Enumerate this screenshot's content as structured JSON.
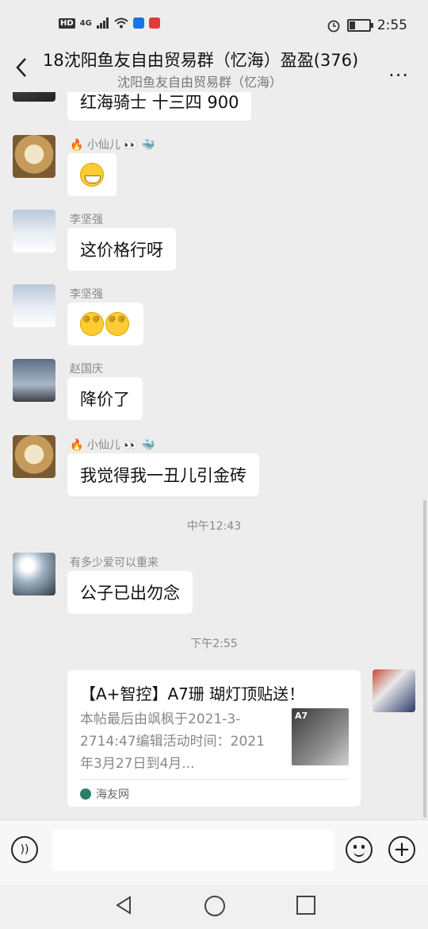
{
  "status_bar": {
    "left_text": "HD",
    "network": "4G",
    "time": "2:55"
  },
  "header": {
    "title": "18沈阳鱼友自由贸易群（忆海）盈盈(376)",
    "subtitle": "沈阳鱼友自由贸易群（忆海）",
    "back_icon": "chevron-left-icon",
    "more_label": "..."
  },
  "messages": [
    {
      "type": "text",
      "sender": "",
      "text": "红海骑士 十三四  900"
    },
    {
      "type": "emoji",
      "sender": "🔥 小仙儿 👀 🐳",
      "emoji": "grin-emoji"
    },
    {
      "type": "text",
      "sender": "李坚强",
      "text": "这价格行呀"
    },
    {
      "type": "emoji",
      "sender": "李坚强",
      "emoji": "dizzy-emoji-pair"
    },
    {
      "type": "text",
      "sender": "赵国庆",
      "text": "降价了"
    },
    {
      "type": "text",
      "sender": "🔥 小仙儿 👀 🐳",
      "text": "我觉得我一丑儿引金砖"
    },
    {
      "type": "time",
      "text": "中午12:43"
    },
    {
      "type": "text",
      "sender": "有多少爱可以重来",
      "text": "公子已出勿念"
    },
    {
      "type": "time",
      "text": "下午2:55"
    }
  ],
  "link_card": {
    "title": "【A+智控】A7珊 瑚灯顶贴送！",
    "description": "本帖最后由飒枫于2021-3-2714:47编辑活动时间：2021年3月27日到4月...",
    "thumb_label": "A7",
    "source": "海友网"
  },
  "input_bar": {
    "placeholder": "",
    "plus_label": "+",
    "voice_label": "))"
  },
  "colors": {
    "background": "#ededed",
    "bubble": "#ffffff",
    "meta_text": "#888888"
  }
}
